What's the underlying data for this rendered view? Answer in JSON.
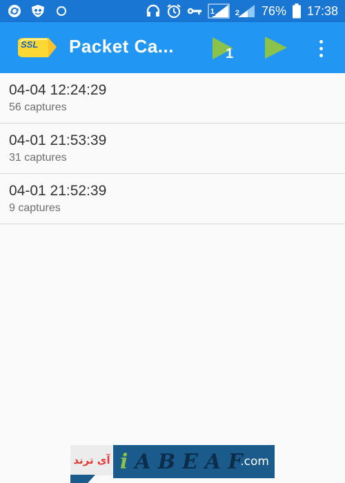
{
  "status_bar": {
    "battery": "76%",
    "time": "17:38",
    "sim1": "1",
    "sim2": "2",
    "icons": [
      "sync-icon",
      "shield-icon",
      "circle-icon",
      "headphones-icon",
      "alarm-icon",
      "key-icon",
      "signal-icon",
      "battery-icon"
    ]
  },
  "app_bar": {
    "title": "Packet Ca...",
    "play_one_badge": "1",
    "colors": {
      "bar": "#2196f3",
      "status": "#1976d2",
      "play": "#8bc34a",
      "logo": "#fdd835"
    }
  },
  "captures": [
    {
      "title": "04-04 12:24:29",
      "subtitle": "56 captures"
    },
    {
      "title": "04-01 21:53:39",
      "subtitle": "31 captures"
    },
    {
      "title": "04-01 21:52:39",
      "subtitle": "9 captures"
    }
  ],
  "watermark": {
    "left_text": "آی ترند",
    "letters": [
      "i",
      "A",
      "B",
      "E",
      "A",
      "F"
    ],
    "suffix": ".com"
  }
}
